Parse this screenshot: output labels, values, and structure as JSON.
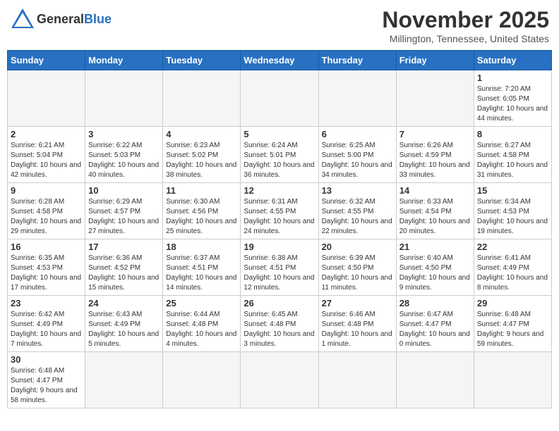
{
  "header": {
    "logo_general": "General",
    "logo_blue": "Blue",
    "month_title": "November 2025",
    "location": "Millington, Tennessee, United States"
  },
  "days_of_week": [
    "Sunday",
    "Monday",
    "Tuesday",
    "Wednesday",
    "Thursday",
    "Friday",
    "Saturday"
  ],
  "weeks": [
    [
      {
        "day": "",
        "info": ""
      },
      {
        "day": "",
        "info": ""
      },
      {
        "day": "",
        "info": ""
      },
      {
        "day": "",
        "info": ""
      },
      {
        "day": "",
        "info": ""
      },
      {
        "day": "",
        "info": ""
      },
      {
        "day": "1",
        "info": "Sunrise: 7:20 AM\nSunset: 6:05 PM\nDaylight: 10 hours and 44 minutes."
      }
    ],
    [
      {
        "day": "2",
        "info": "Sunrise: 6:21 AM\nSunset: 5:04 PM\nDaylight: 10 hours and 42 minutes."
      },
      {
        "day": "3",
        "info": "Sunrise: 6:22 AM\nSunset: 5:03 PM\nDaylight: 10 hours and 40 minutes."
      },
      {
        "day": "4",
        "info": "Sunrise: 6:23 AM\nSunset: 5:02 PM\nDaylight: 10 hours and 38 minutes."
      },
      {
        "day": "5",
        "info": "Sunrise: 6:24 AM\nSunset: 5:01 PM\nDaylight: 10 hours and 36 minutes."
      },
      {
        "day": "6",
        "info": "Sunrise: 6:25 AM\nSunset: 5:00 PM\nDaylight: 10 hours and 34 minutes."
      },
      {
        "day": "7",
        "info": "Sunrise: 6:26 AM\nSunset: 4:59 PM\nDaylight: 10 hours and 33 minutes."
      },
      {
        "day": "8",
        "info": "Sunrise: 6:27 AM\nSunset: 4:58 PM\nDaylight: 10 hours and 31 minutes."
      }
    ],
    [
      {
        "day": "9",
        "info": "Sunrise: 6:28 AM\nSunset: 4:58 PM\nDaylight: 10 hours and 29 minutes."
      },
      {
        "day": "10",
        "info": "Sunrise: 6:29 AM\nSunset: 4:57 PM\nDaylight: 10 hours and 27 minutes."
      },
      {
        "day": "11",
        "info": "Sunrise: 6:30 AM\nSunset: 4:56 PM\nDaylight: 10 hours and 25 minutes."
      },
      {
        "day": "12",
        "info": "Sunrise: 6:31 AM\nSunset: 4:55 PM\nDaylight: 10 hours and 24 minutes."
      },
      {
        "day": "13",
        "info": "Sunrise: 6:32 AM\nSunset: 4:55 PM\nDaylight: 10 hours and 22 minutes."
      },
      {
        "day": "14",
        "info": "Sunrise: 6:33 AM\nSunset: 4:54 PM\nDaylight: 10 hours and 20 minutes."
      },
      {
        "day": "15",
        "info": "Sunrise: 6:34 AM\nSunset: 4:53 PM\nDaylight: 10 hours and 19 minutes."
      }
    ],
    [
      {
        "day": "16",
        "info": "Sunrise: 6:35 AM\nSunset: 4:53 PM\nDaylight: 10 hours and 17 minutes."
      },
      {
        "day": "17",
        "info": "Sunrise: 6:36 AM\nSunset: 4:52 PM\nDaylight: 10 hours and 15 minutes."
      },
      {
        "day": "18",
        "info": "Sunrise: 6:37 AM\nSunset: 4:51 PM\nDaylight: 10 hours and 14 minutes."
      },
      {
        "day": "19",
        "info": "Sunrise: 6:38 AM\nSunset: 4:51 PM\nDaylight: 10 hours and 12 minutes."
      },
      {
        "day": "20",
        "info": "Sunrise: 6:39 AM\nSunset: 4:50 PM\nDaylight: 10 hours and 11 minutes."
      },
      {
        "day": "21",
        "info": "Sunrise: 6:40 AM\nSunset: 4:50 PM\nDaylight: 10 hours and 9 minutes."
      },
      {
        "day": "22",
        "info": "Sunrise: 6:41 AM\nSunset: 4:49 PM\nDaylight: 10 hours and 8 minutes."
      }
    ],
    [
      {
        "day": "23",
        "info": "Sunrise: 6:42 AM\nSunset: 4:49 PM\nDaylight: 10 hours and 7 minutes."
      },
      {
        "day": "24",
        "info": "Sunrise: 6:43 AM\nSunset: 4:49 PM\nDaylight: 10 hours and 5 minutes."
      },
      {
        "day": "25",
        "info": "Sunrise: 6:44 AM\nSunset: 4:48 PM\nDaylight: 10 hours and 4 minutes."
      },
      {
        "day": "26",
        "info": "Sunrise: 6:45 AM\nSunset: 4:48 PM\nDaylight: 10 hours and 3 minutes."
      },
      {
        "day": "27",
        "info": "Sunrise: 6:46 AM\nSunset: 4:48 PM\nDaylight: 10 hours and 1 minute."
      },
      {
        "day": "28",
        "info": "Sunrise: 6:47 AM\nSunset: 4:47 PM\nDaylight: 10 hours and 0 minutes."
      },
      {
        "day": "29",
        "info": "Sunrise: 6:48 AM\nSunset: 4:47 PM\nDaylight: 9 hours and 59 minutes."
      }
    ],
    [
      {
        "day": "30",
        "info": "Sunrise: 6:48 AM\nSunset: 4:47 PM\nDaylight: 9 hours and 58 minutes."
      },
      {
        "day": "",
        "info": ""
      },
      {
        "day": "",
        "info": ""
      },
      {
        "day": "",
        "info": ""
      },
      {
        "day": "",
        "info": ""
      },
      {
        "day": "",
        "info": ""
      },
      {
        "day": "",
        "info": ""
      }
    ]
  ]
}
